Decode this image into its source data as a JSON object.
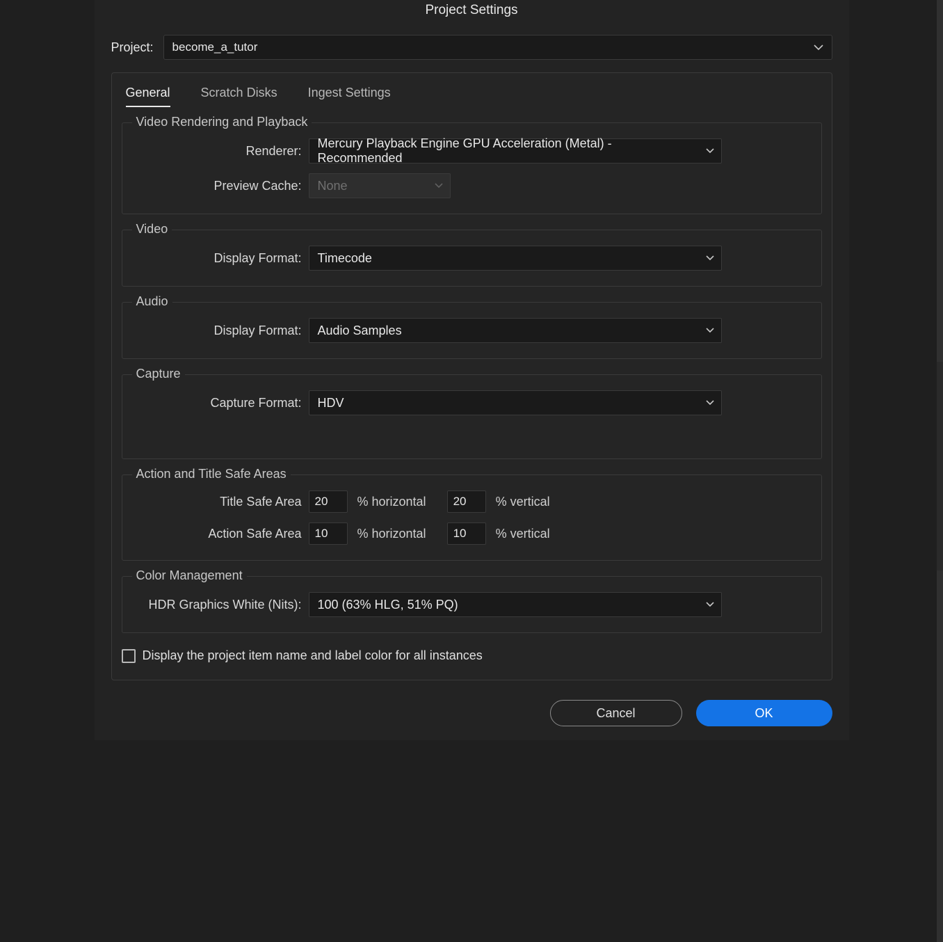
{
  "dialog": {
    "title": "Project Settings",
    "project_label": "Project:",
    "project_value": "become_a_tutor"
  },
  "tabs": {
    "general": "General",
    "scratch_disks": "Scratch Disks",
    "ingest_settings": "Ingest Settings"
  },
  "sections": {
    "video_rendering": {
      "legend": "Video Rendering and Playback",
      "renderer_label": "Renderer:",
      "renderer_value": "Mercury Playback Engine GPU Acceleration (Metal) - Recommended",
      "preview_cache_label": "Preview Cache:",
      "preview_cache_value": "None"
    },
    "video": {
      "legend": "Video",
      "display_format_label": "Display Format:",
      "display_format_value": "Timecode"
    },
    "audio": {
      "legend": "Audio",
      "display_format_label": "Display Format:",
      "display_format_value": "Audio Samples"
    },
    "capture": {
      "legend": "Capture",
      "capture_format_label": "Capture Format:",
      "capture_format_value": "HDV"
    },
    "safe_areas": {
      "legend": "Action and Title Safe Areas",
      "title_safe_label": "Title Safe Area",
      "title_safe_h": "20",
      "title_safe_v": "20",
      "action_safe_label": "Action Safe Area",
      "action_safe_h": "10",
      "action_safe_v": "10",
      "pct_horizontal": "% horizontal",
      "pct_vertical": "% vertical"
    },
    "color_management": {
      "legend": "Color Management",
      "hdr_label": "HDR Graphics White (Nits):",
      "hdr_value": "100 (63% HLG, 51% PQ)"
    }
  },
  "checkbox": {
    "label": "Display the project item name and label color for all instances",
    "checked": false
  },
  "footer": {
    "cancel": "Cancel",
    "ok": "OK"
  }
}
